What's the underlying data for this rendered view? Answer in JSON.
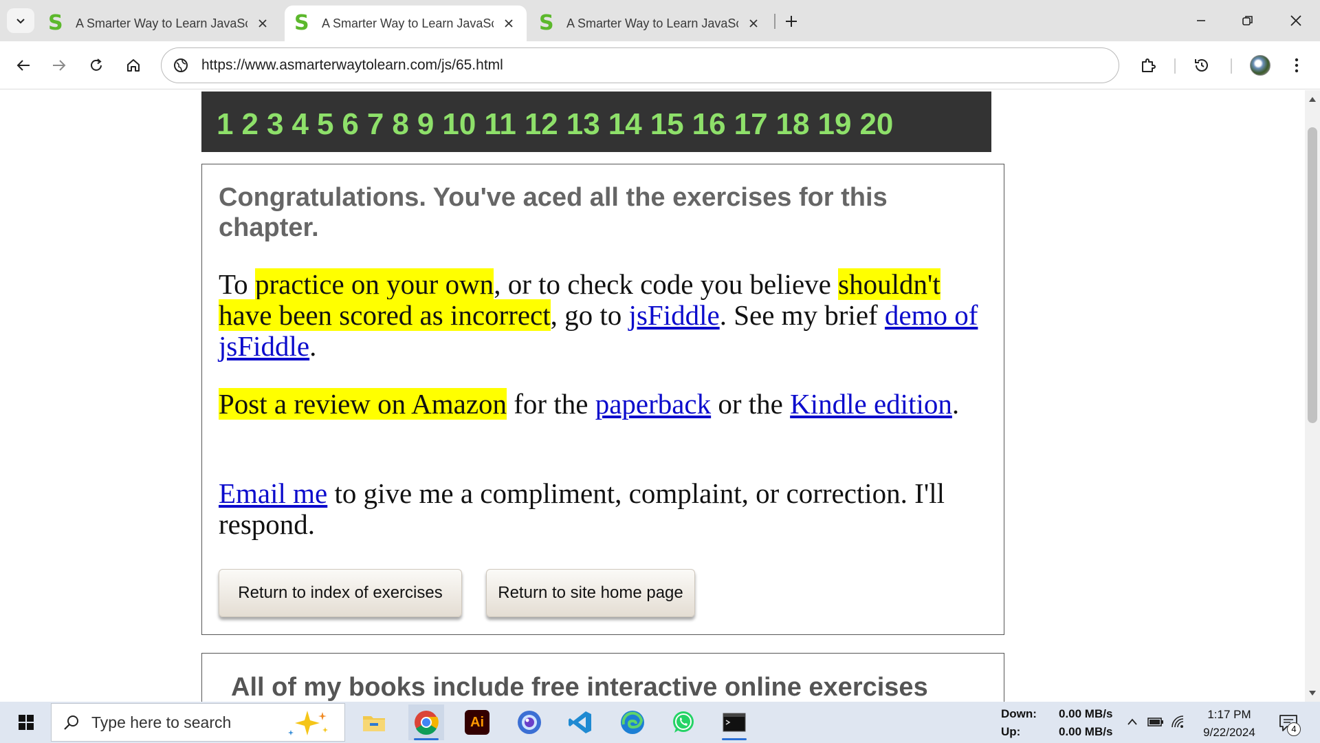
{
  "browser": {
    "tabs": [
      {
        "title": "A Smarter Way to Learn JavaScr",
        "favicon": "S",
        "active": false
      },
      {
        "title": "A Smarter Way to Learn JavaScr",
        "favicon": "S",
        "active": true
      },
      {
        "title": "A Smarter Way to Learn JavaScr",
        "favicon": "S",
        "active": false
      }
    ],
    "url": "https://www.asmarterwaytolearn.com/js/65.html"
  },
  "page": {
    "exercise_numbers": [
      "1",
      "2",
      "3",
      "4",
      "5",
      "6",
      "7",
      "8",
      "9",
      "10",
      "11",
      "12",
      "13",
      "14",
      "15",
      "16",
      "17",
      "18",
      "19",
      "20"
    ],
    "congrats": "Congratulations. You've aced all the exercises for this chapter.",
    "practice": {
      "t1": "To ",
      "h1": "practice on your own",
      "t2": ", or to check code you believe ",
      "h2": "shouldn't have been scored as incorrect",
      "t3": ", go to ",
      "link1": "jsFiddle",
      "t4": ". See my brief ",
      "link2": "demo of jsFiddle",
      "t5": "."
    },
    "review": {
      "h1": "Post a review on Amazon",
      "t1": " for the ",
      "link1": "paperback",
      "t2": " or the ",
      "link2": "Kindle edition",
      "t3": "."
    },
    "email": {
      "link1": "Email me",
      "t1": " to give me a compliment, complaint, or correction. I'll respond."
    },
    "buttons": {
      "index": "Return to index of exercises",
      "home": "Return to site home page"
    },
    "books_heading": "All of my books include free interactive online exercises"
  },
  "taskbar": {
    "search_placeholder": "Type here to search",
    "net_down_label": "Down:",
    "net_down_value": "0.00 MB/s",
    "net_up_label": "Up:",
    "net_up_value": "0.00 MB/s",
    "time": "1:17 PM",
    "date": "9/22/2024",
    "notifications": "4"
  },
  "colors": {
    "highlight": "#ffff00",
    "link": "#0b0bcc",
    "nav_bg": "#333333",
    "nav_numbers": "#8ee06a",
    "favicon": "#5cb82c"
  }
}
